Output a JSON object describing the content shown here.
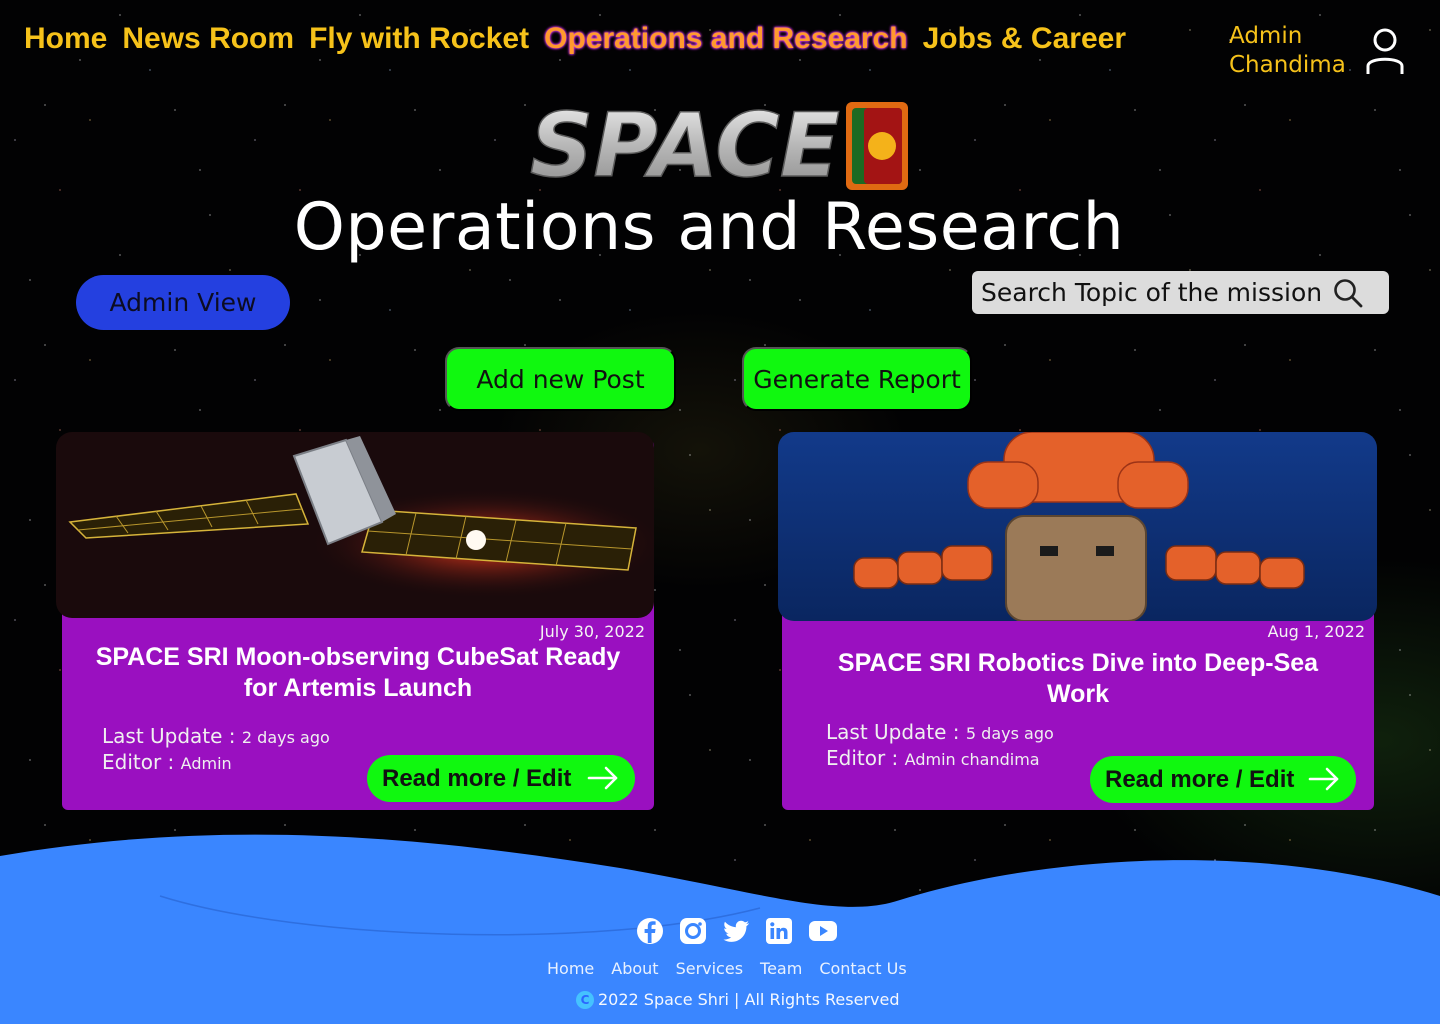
{
  "nav": {
    "items": [
      {
        "label": "Home",
        "active": false
      },
      {
        "label": "News Room",
        "active": false
      },
      {
        "label": "Fly with Rocket",
        "active": false
      },
      {
        "label": "Operations and Research",
        "active": true
      },
      {
        "label": "Jobs & Career",
        "active": false
      }
    ],
    "user_name": "Admin Chandima",
    "user_icon": "user-icon"
  },
  "hero": {
    "logo_text": "SPACE",
    "title": "Operations and Research"
  },
  "toolbar": {
    "admin_view": "Admin View",
    "search_placeholder": "Search Topic of the mission",
    "add_post": "Add new Post",
    "generate_report": "Generate Report"
  },
  "posts": [
    {
      "date": "July 30, 2022",
      "title": "SPACE SRI  Moon-observing CubeSat Ready for Artemis Launch",
      "last_update_label": "Last Update :",
      "last_update_value": "2 days ago",
      "editor_label": "Editor :",
      "editor_value": "Admin",
      "button": "Read more / Edit"
    },
    {
      "date": "Aug 1, 2022",
      "title": "SPACE SRI Robotics Dive into Deep-Sea Work",
      "last_update_label": "Last Update :",
      "last_update_value": "5 days ago",
      "editor_label": "Editor :",
      "editor_value": "Admin chandima",
      "button": "Read more / Edit"
    }
  ],
  "footer": {
    "socials": [
      "facebook-icon",
      "instagram-icon",
      "twitter-icon",
      "linkedin-icon",
      "youtube-icon"
    ],
    "links": [
      "Home",
      "About",
      "Services",
      "Team",
      "Contact Us"
    ],
    "copyright": "2022 Space Shri | All Rights Reserved"
  },
  "colors": {
    "nav_text": "#f6c21a",
    "admin_button": "#2440e0",
    "action_button": "#10f80f",
    "card_bg": "#9a10c0",
    "footer_bg": "#3a86ff"
  }
}
